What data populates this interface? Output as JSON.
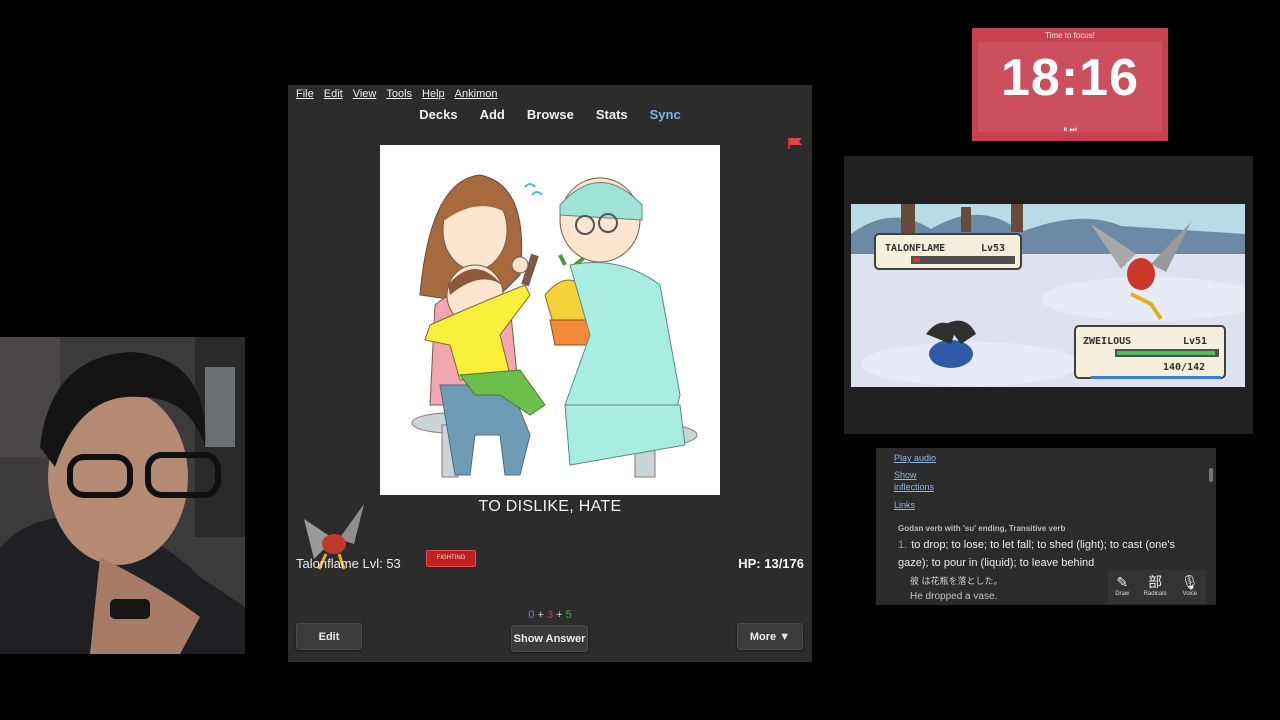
{
  "anki": {
    "menu": [
      "File",
      "Edit",
      "View",
      "Tools",
      "Help",
      "Ankimon"
    ],
    "toolbar": {
      "decks": "Decks",
      "add": "Add",
      "browse": "Browse",
      "stats": "Stats",
      "sync": "Sync"
    },
    "card": {
      "meaning": "TO DISLIKE, HATE"
    },
    "pokemon": {
      "name_level": "Talonflame Lvl: 53",
      "type": "FIGHTING",
      "hp": "HP: 13/176"
    },
    "counts": {
      "new": "0",
      "learning": "3",
      "review": "5",
      "plus": "+"
    },
    "buttons": {
      "edit": "Edit",
      "show_answer": "Show Answer",
      "more": "More ▼"
    }
  },
  "timer": {
    "title": "Time to focus!",
    "time": "18:16",
    "controls": "⏸ ⏭"
  },
  "game": {
    "enemy": {
      "name": "TALONFLAME",
      "level": "Lv53",
      "hp_fraction": 0.07
    },
    "player": {
      "name": "ZWEILOUS",
      "level": "Lv51",
      "hp_text": "140/142",
      "hp_fraction": 0.98
    }
  },
  "dictionary": {
    "play_audio": "Play audio",
    "show": "Show",
    "inflections": "inflections",
    "links": "Links",
    "pos": "Godan verb with 'su' ending, Transitive verb",
    "def_num": "1.",
    "definition": "to drop; to lose; to let fall; to shed (light); to cast (one's gaze); to pour in (liquid); to leave behind",
    "example_jp": "彼 は花瓶を落とした。",
    "example_en": "He dropped a vase.",
    "tools": {
      "draw": "Draw",
      "radicals": "Radicals",
      "voice": "Voice",
      "radicals_glyph": "部"
    }
  },
  "colors": {
    "sync": "#7fb0e8",
    "new": "#4c8fe6",
    "learning": "#d13c3c",
    "review": "#45a844",
    "timer_bg": "#c84150"
  }
}
